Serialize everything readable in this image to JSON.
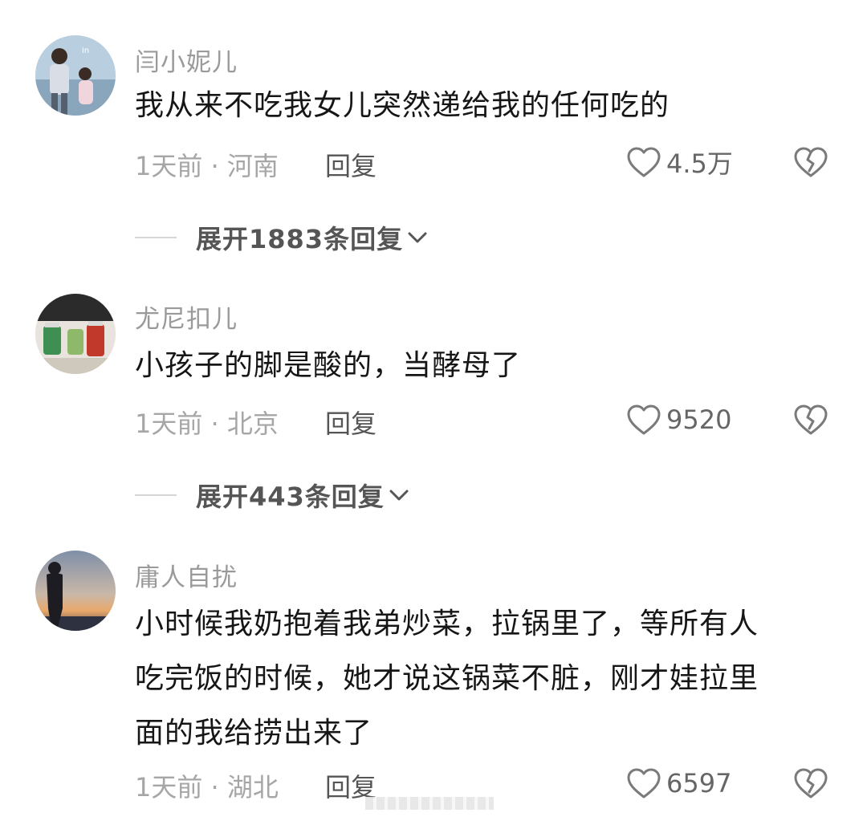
{
  "comments": [
    {
      "username": "闫小妮儿",
      "text": "我从来不吃我女儿突然递给我的任何吃的",
      "time": "1天前",
      "location": "河南",
      "reply_label": "回复",
      "likes": "4.5万",
      "expand_label": "展开1883条回复"
    },
    {
      "username": "尤尼扣儿",
      "text": "小孩子的脚是酸的，当酵母了",
      "time": "1天前",
      "location": "北京",
      "reply_label": "回复",
      "likes": "9520",
      "expand_label": "展开443条回复"
    },
    {
      "username": "庸人自扰",
      "text_lines": [
        "小时候我奶抱着我弟炒菜，拉锅里了，等所有人",
        "吃完饭的时候，她才说这锅菜不脏，刚才娃拉里",
        "面的我给捞出来了"
      ],
      "time": "1天前",
      "location": "湖北",
      "reply_label": "回复",
      "likes": "6597"
    }
  ],
  "separator": " · ",
  "colors": {
    "username": "#9a9a9a",
    "text": "#161616",
    "meta": "#a6a6a6",
    "action": "#555555"
  },
  "icons": {
    "like": "heart-outline-icon",
    "dislike": "broken-heart-icon",
    "expand": "chevron-down-icon"
  }
}
